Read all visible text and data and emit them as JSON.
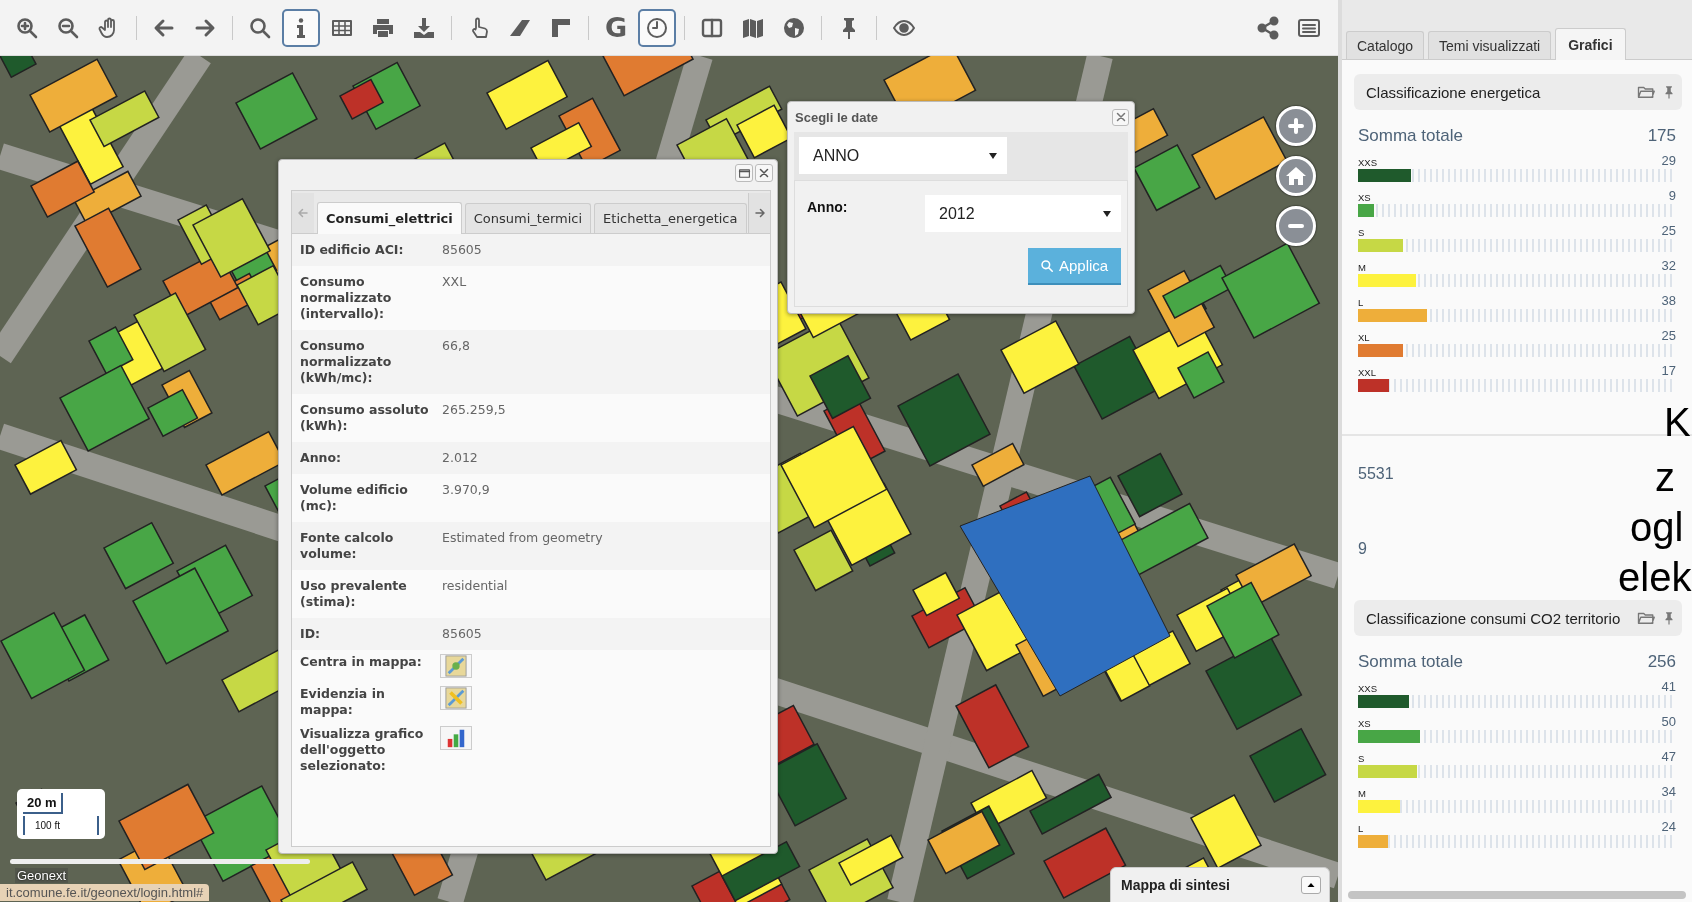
{
  "toolbar": {
    "buttons": [
      {
        "selected": false
      },
      {
        "selected": false
      },
      {
        "selected": false
      },
      {
        "selected": false
      },
      {
        "selected": false
      },
      {
        "selected": false
      },
      {
        "selected": true
      },
      {
        "selected": false
      },
      {
        "selected": false
      },
      {
        "selected": false
      },
      {
        "selected": false
      },
      {
        "selected": false
      },
      {
        "selected": false
      },
      {
        "selected": false,
        "label": "G"
      },
      {
        "selected": true
      },
      {
        "selected": false
      },
      {
        "selected": false
      },
      {
        "selected": false
      },
      {
        "selected": false
      },
      {
        "selected": false
      }
    ],
    "right_buttons": [
      {
        "selected": false
      },
      {
        "selected": false
      }
    ]
  },
  "map": {
    "scale_metric": "20 m",
    "scale_imperial": "100 ft",
    "attribution": "Geonext",
    "status_url": "it.comune.fe.it/geonext/login.html#",
    "overview_title": "Mappa di sintesi"
  },
  "feature_popup": {
    "tabs": [
      {
        "label": "Consumi_elettrici",
        "selected": true
      },
      {
        "label": "Consumi_termici",
        "selected": false
      },
      {
        "label": "Etichetta_energetica",
        "selected": false
      }
    ],
    "rows": [
      {
        "kind": "text",
        "label": "ID edificio ACI:",
        "value": "85605"
      },
      {
        "kind": "text",
        "label": "Consumo normalizzato (intervallo):",
        "value": "XXL"
      },
      {
        "kind": "text",
        "label": "Consumo normalizzato (kWh/mc):",
        "value": "66,8"
      },
      {
        "kind": "text",
        "label": "Consumo assoluto (kWh):",
        "value": "265.259,5"
      },
      {
        "kind": "text",
        "label": "Anno:",
        "value": "2.012"
      },
      {
        "kind": "text",
        "label": "Volume edificio (mc):",
        "value": "3.970,9"
      },
      {
        "kind": "text",
        "label": "Fonte calcolo volume:",
        "value": "Estimated from geometry"
      },
      {
        "kind": "text",
        "label": "Uso prevalente (stima):",
        "value": "residential"
      },
      {
        "kind": "text",
        "label": "ID:",
        "value": "85605"
      },
      {
        "kind": "locate",
        "label": "Centra in mappa:"
      },
      {
        "kind": "highlight",
        "label": "Evidenzia in mappa:"
      },
      {
        "kind": "chart",
        "label": "Visualizza grafico dell'oggetto selezionato:"
      }
    ]
  },
  "date_dialog": {
    "title": "Scegli le date",
    "period": "ANNO",
    "year_label": "Anno:",
    "year": "2012",
    "apply": "Applica"
  },
  "side_panel": {
    "tabs": [
      {
        "label": "Catalogo",
        "selected": false
      },
      {
        "label": "Temi visualizzati",
        "selected": false
      },
      {
        "label": "Grafici",
        "selected": true
      }
    ],
    "sections": [
      {
        "kind": "chart",
        "title": "Classificazione energetica",
        "total_label": "Somma totale",
        "total": "175",
        "items": [
          {
            "label": "XXS",
            "value": "29",
            "level": 0.166,
            "color": "#1f5a2c"
          },
          {
            "label": "XS",
            "value": "9",
            "level": 0.051,
            "color": "#48a646"
          },
          {
            "label": "S",
            "value": "25",
            "level": 0.143,
            "color": "#c6d845"
          },
          {
            "label": "M",
            "value": "32",
            "level": 0.183,
            "color": "#fdf23e"
          },
          {
            "label": "L",
            "value": "38",
            "level": 0.217,
            "color": "#eeae3a"
          },
          {
            "label": "XL",
            "value": "25",
            "level": 0.143,
            "color": "#e07b31"
          },
          {
            "label": "XXL",
            "value": "17",
            "level": 0.097,
            "color": "#bd3128"
          }
        ]
      },
      {
        "kind": "figure",
        "value": "5531"
      },
      {
        "kind": "figure",
        "value": "9"
      },
      {
        "kind": "chart",
        "title": "Classificazione consumi CO2 territorio",
        "total_label": "Somma totale",
        "total": "256",
        "items": [
          {
            "label": "XXS",
            "value": "41",
            "level": 0.16,
            "color": "#1f5a2c"
          },
          {
            "label": "XS",
            "value": "50",
            "level": 0.195,
            "color": "#48a646"
          },
          {
            "label": "S",
            "value": "47",
            "level": 0.184,
            "color": "#c6d845"
          },
          {
            "label": "M",
            "value": "34",
            "level": 0.133,
            "color": "#fdf23e"
          },
          {
            "label": "L",
            "value": "24",
            "level": 0.094,
            "color": "#eeae3a"
          }
        ]
      }
    ]
  },
  "overlay_text": [
    "K",
    "z",
    "ogl",
    "elek"
  ]
}
